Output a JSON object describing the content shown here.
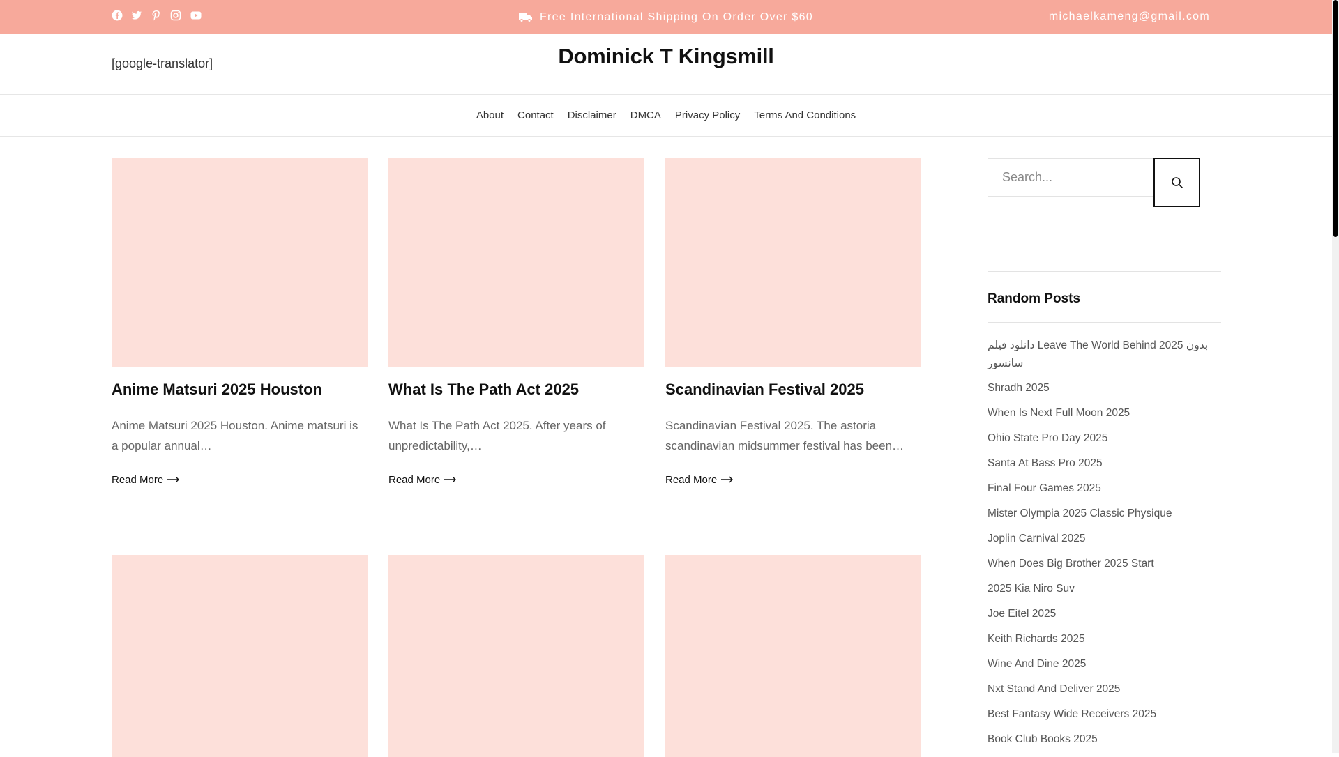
{
  "topbar": {
    "social_icons": [
      "facebook-icon",
      "twitter-icon",
      "pinterest-icon",
      "instagram-icon",
      "youtube-icon"
    ],
    "shipping_text": "Free International Shipping On Order Over $60",
    "email": "michaelkameng@gmail.com",
    "background": "#f7a99b"
  },
  "header": {
    "translator": "[google-translator]",
    "site_title": "Dominick T Kingsmill"
  },
  "nav": {
    "items": [
      "About",
      "Contact",
      "Disclaimer",
      "DMCA",
      "Privacy Policy",
      "Terms And Conditions"
    ]
  },
  "posts": [
    {
      "title": "Anime Matsuri 2025 Houston",
      "excerpt": "Anime Matsuri 2025 Houston. Anime matsuri is a popular annual…",
      "read_more": "Read More"
    },
    {
      "title": "What Is The Path Act 2025",
      "excerpt": "What Is The Path Act 2025. After years of unpredictability,…",
      "read_more": "Read More"
    },
    {
      "title": "Scandinavian Festival 2025",
      "excerpt": "Scandinavian Festival 2025. The astoria scandinavian midsummer festival has been…",
      "read_more": "Read More"
    }
  ],
  "sidebar": {
    "search_placeholder": "Search...",
    "random_title": "Random Posts",
    "random_posts": [
      "دانلود فیلم Leave The World Behind 2025 بدون سانسور",
      "Shradh 2025",
      "When Is Next Full Moon 2025",
      "Ohio State Pro Day 2025",
      "Santa At Bass Pro 2025",
      "Final Four Games 2025",
      "Mister Olympia 2025 Classic Physique",
      "Joplin Carnival 2025",
      "When Does Big Brother 2025 Start",
      "2025 Kia Niro Suv",
      "Joe Eitel 2025",
      "Keith Richards 2025",
      "Wine And Dine 2025",
      "Nxt Stand And Deliver 2025",
      "Best Fantasy Wide Receivers 2025",
      "Book Club Books 2025"
    ]
  },
  "colors": {
    "accent": "#f7a99b",
    "thumb_placeholder": "#fde0da"
  }
}
